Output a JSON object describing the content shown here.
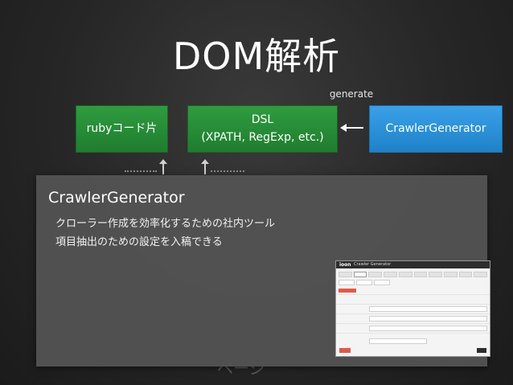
{
  "slide": {
    "title": "DOM解析",
    "generate_label": "generate",
    "bottom_text": "ページ"
  },
  "boxes": {
    "ruby_code": "rubyコード片",
    "dsl_line1": "DSL",
    "dsl_line2": "(XPATH, RegExp, etc.)",
    "crawler_generator": "CrawlerGenerator"
  },
  "overlay": {
    "title": "CrawlerGenerator",
    "lines": [
      "クローラー作成を効率化するための社内ツール",
      "項目抽出のための設定を入稿できる"
    ]
  },
  "thumbnail": {
    "logo": "ioon",
    "app_title": "Crawler Generator"
  },
  "colors": {
    "green_box": "#2f9c3f",
    "blue_box": "#3aa0e8",
    "overlay_bg": "#545454",
    "background": "#262626"
  }
}
